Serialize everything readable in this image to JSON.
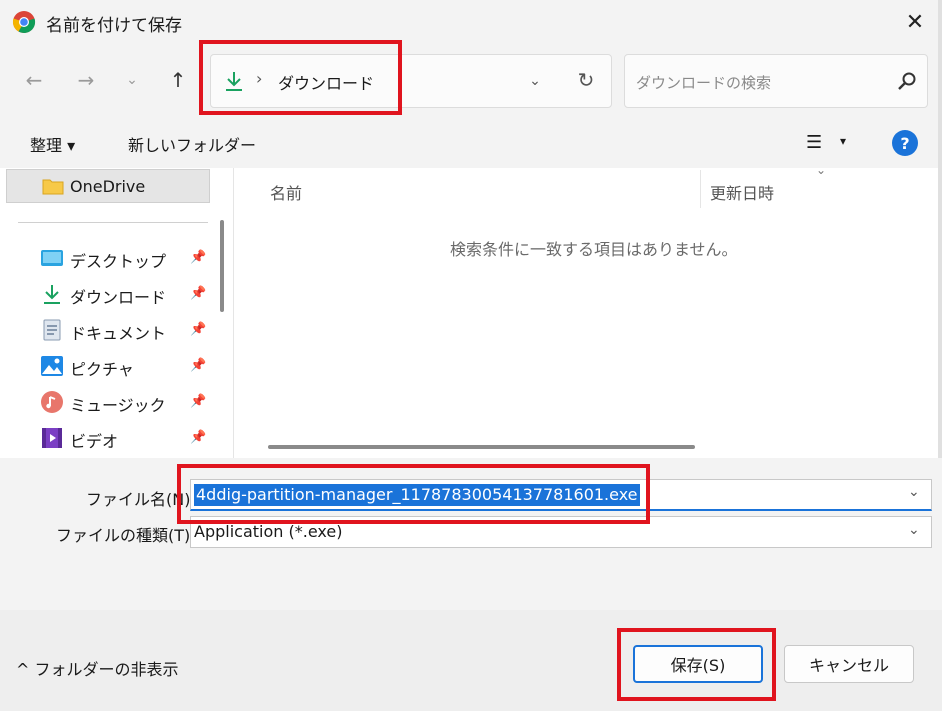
{
  "window": {
    "title": "名前を付けて保存",
    "close_symbol": "✕"
  },
  "nav": {
    "back_symbol": "←",
    "forward_symbol": "→",
    "recent_symbol": "⌄",
    "up_symbol": "↑",
    "address": {
      "separator": "›",
      "current": "ダウンロード",
      "dropdown_symbol": "⌄",
      "refresh_symbol": "↻"
    },
    "search": {
      "placeholder": "ダウンロードの検索"
    }
  },
  "toolbar": {
    "organize_label": "整理 ▾",
    "new_folder_label": "新しいフォルダー",
    "view_symbol": "☰",
    "view_dropdown_symbol": "▾",
    "help_symbol": "?"
  },
  "sidebar": {
    "onedrive_label": "OneDrive",
    "pin_symbol": "📌",
    "items": [
      {
        "label": "デスクトップ",
        "icon": "desktop-icon"
      },
      {
        "label": "ダウンロード",
        "icon": "download-icon"
      },
      {
        "label": "ドキュメント",
        "icon": "document-icon"
      },
      {
        "label": "ピクチャ",
        "icon": "picture-icon"
      },
      {
        "label": "ミュージック",
        "icon": "music-icon"
      },
      {
        "label": "ビデオ",
        "icon": "video-icon"
      }
    ]
  },
  "file_list": {
    "columns": [
      "名前",
      "更新日時"
    ],
    "sort_symbol": "⌄",
    "empty_message": "検索条件に一致する項目はありません。"
  },
  "form": {
    "filename_label": "ファイル名(N):",
    "filename_value": "4ddig-partition-manager_11787830054137781601.exe",
    "filetype_label": "ファイルの種類(T):",
    "filetype_value": "Application (*.exe)",
    "dropdown_symbol": "⌄"
  },
  "footer": {
    "hide_folders_label": "^ フォルダーの非表示",
    "save_label": "保存(S)",
    "cancel_label": "キャンセル"
  },
  "colors": {
    "highlight": "#e0141e",
    "accent": "#1a73d9",
    "download_green": "#1aa260"
  }
}
